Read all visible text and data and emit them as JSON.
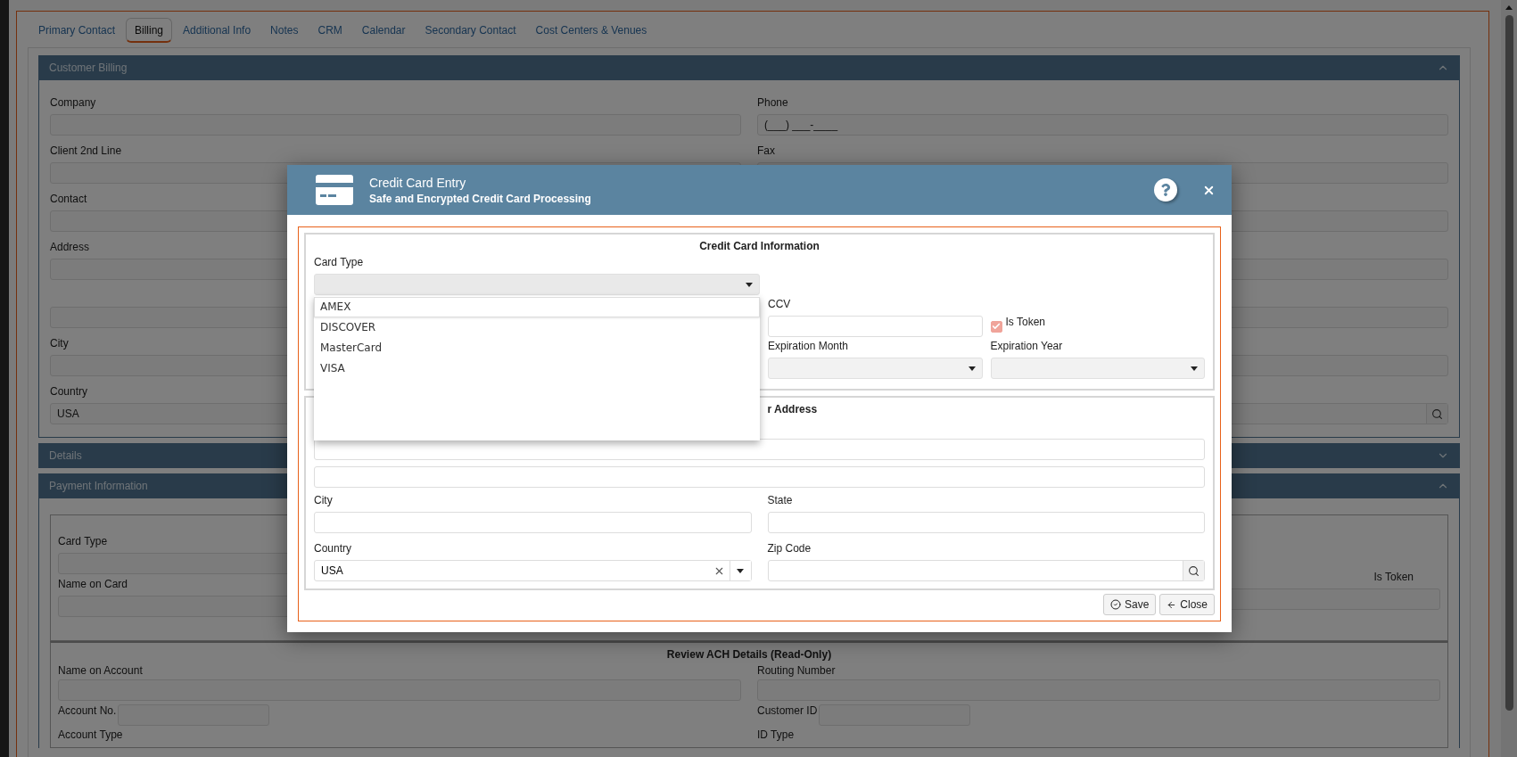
{
  "tabs": [
    {
      "label": "Primary Contact",
      "selected": false
    },
    {
      "label": "Billing",
      "selected": true
    },
    {
      "label": "Additional Info",
      "selected": false
    },
    {
      "label": "Notes",
      "selected": false
    },
    {
      "label": "CRM",
      "selected": false
    },
    {
      "label": "Calendar",
      "selected": false
    },
    {
      "label": "Secondary Contact",
      "selected": false
    },
    {
      "label": "Cost Centers & Venues",
      "selected": false
    }
  ],
  "customer_billing": {
    "title": "Customer Billing",
    "expanded": true,
    "rows": [
      {
        "left": {
          "kind": "text",
          "label": "Company"
        },
        "right": {
          "kind": "text",
          "label": "Phone",
          "value": "(___) ___-____"
        }
      },
      {
        "left": {
          "kind": "text",
          "label": "Client 2nd Line"
        },
        "right": {
          "kind": "text",
          "label": "Fax"
        }
      },
      {
        "left": {
          "kind": "text",
          "label": "Contact"
        },
        "right": {
          "kind": "short"
        }
      },
      {
        "left": {
          "kind": "text",
          "label": "Address"
        },
        "right": {
          "kind": "text"
        }
      },
      {
        "left": {
          "kind": "text"
        },
        "right": {
          "kind": "text"
        }
      },
      {
        "left": {
          "kind": "text",
          "label": "City"
        },
        "right": {
          "kind": "text"
        }
      },
      {
        "left": {
          "kind": "text",
          "label": "Country",
          "value": "USA"
        },
        "right": {
          "kind": "lookup"
        }
      }
    ]
  },
  "details": {
    "title": "Details",
    "expanded": false
  },
  "payment_information": {
    "title": "Payment Information",
    "expanded": true,
    "card_fields": [
      {
        "label": "Card Type"
      },
      {
        "label": "Name on Card"
      }
    ],
    "is_token": {
      "label": "Is Token"
    },
    "ach": {
      "title": "Review ACH Details (Read-Only)",
      "rows": [
        {
          "left": {
            "kind": "stacked",
            "label": "Name on Account"
          },
          "right": {
            "kind": "stacked",
            "label": "Routing Number"
          }
        },
        {
          "left": {
            "kind": "inline",
            "label": "Account No."
          },
          "right": {
            "kind": "inline",
            "label": "Customer ID"
          }
        },
        {
          "left": {
            "kind": "label",
            "label": "Account Type"
          },
          "right": {
            "kind": "label",
            "label": "ID Type"
          }
        }
      ]
    }
  },
  "modal": {
    "title": "Credit Card Entry",
    "subtitle": "Safe and Encrypted Credit Card Processing",
    "card_section": {
      "title": "Credit Card Information",
      "card_type": {
        "label": "Card Type",
        "expanded": true,
        "options": [
          {
            "label": "AMEX",
            "selected": true
          },
          {
            "label": "DISCOVER",
            "selected": false
          },
          {
            "label": "MasterCard",
            "selected": false
          },
          {
            "label": "VISA",
            "selected": false
          }
        ]
      },
      "ccv": {
        "label": "CCV"
      },
      "is_token": {
        "label": "Is Token",
        "checked": true
      },
      "expiration_month": {
        "label": "Expiration Month"
      },
      "expiration_year": {
        "label": "Expiration Year"
      }
    },
    "address_section": {
      "title": "r Address",
      "city": {
        "label": "City"
      },
      "state": {
        "label": "State"
      },
      "country": {
        "label": "Country",
        "value": "USA"
      },
      "zip_code": {
        "label": "Zip Code"
      }
    },
    "buttons": [
      {
        "kind": "save",
        "label": "Save"
      },
      {
        "kind": "close",
        "label": "Close"
      }
    ]
  }
}
